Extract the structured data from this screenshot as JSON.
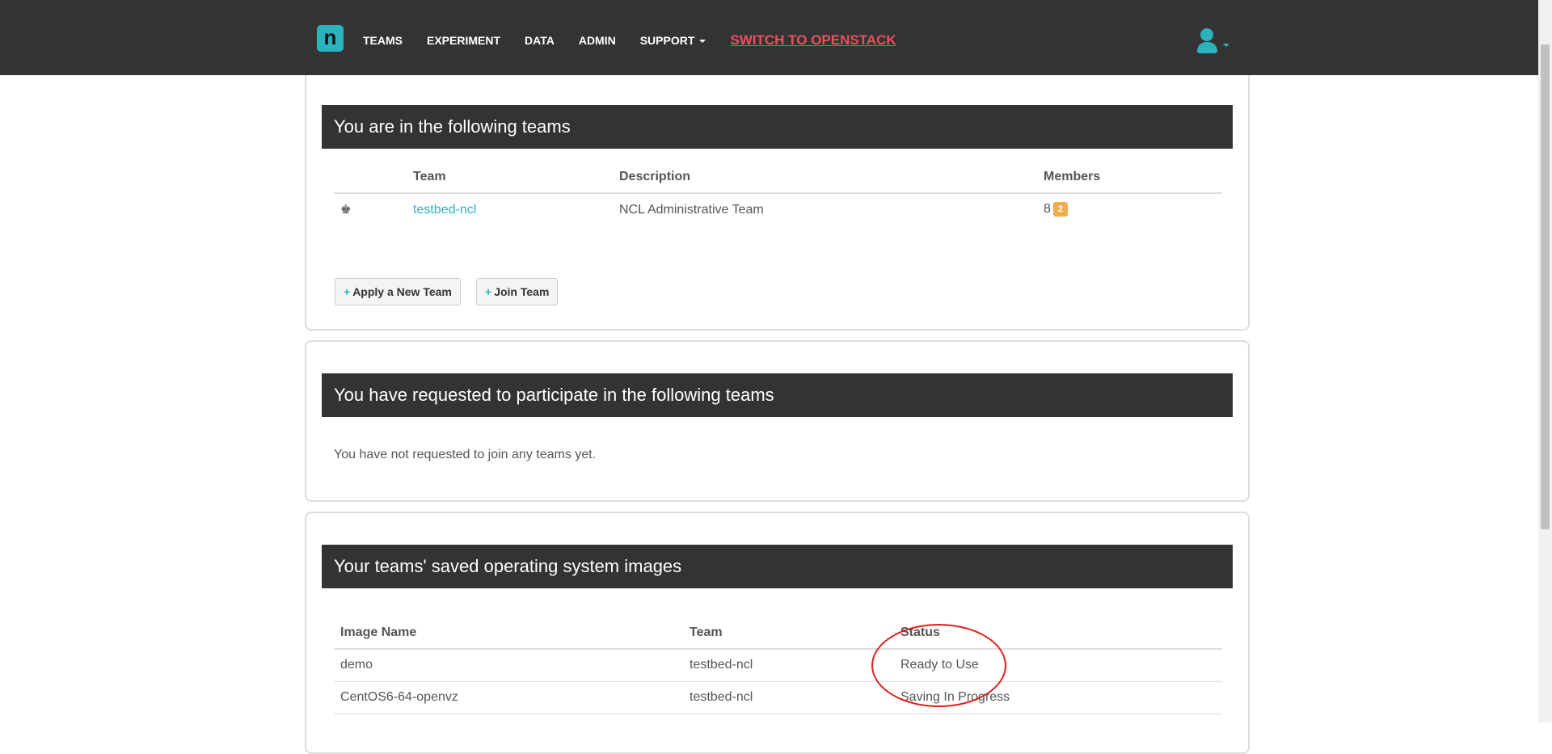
{
  "navbar": {
    "brand_letter": "n",
    "items": [
      {
        "label": "TEAMS"
      },
      {
        "label": "EXPERIMENT"
      },
      {
        "label": "DATA"
      },
      {
        "label": "ADMIN"
      },
      {
        "label": "SUPPORT"
      }
    ],
    "switch_label": "SWITCH TO OPENSTACK",
    "accent_color": "#2ab3bd",
    "switch_color": "#e8505b"
  },
  "teams_panel": {
    "heading": "You are in the following teams",
    "columns": [
      "Team",
      "Description",
      "Members"
    ],
    "rows": [
      {
        "icon": "leader-icon",
        "team": "testbed-ncl",
        "description": "NCL Administrative Team",
        "members": "8",
        "pending_badge": "2"
      }
    ],
    "apply_button": "Apply a New Team",
    "join_button": "Join Team"
  },
  "requests_panel": {
    "heading": "You have requested to participate in the following teams",
    "empty_message": "You have not requested to join any teams yet."
  },
  "images_panel": {
    "heading": "Your teams' saved operating system images",
    "columns": [
      "Image Name",
      "Team",
      "Status"
    ],
    "rows": [
      {
        "image_name": "demo",
        "team": "testbed-ncl",
        "status": "Ready to Use"
      },
      {
        "image_name": "CentOS6-64-openvz",
        "team": "testbed-ncl",
        "status": "Saving In Progress"
      }
    ]
  }
}
